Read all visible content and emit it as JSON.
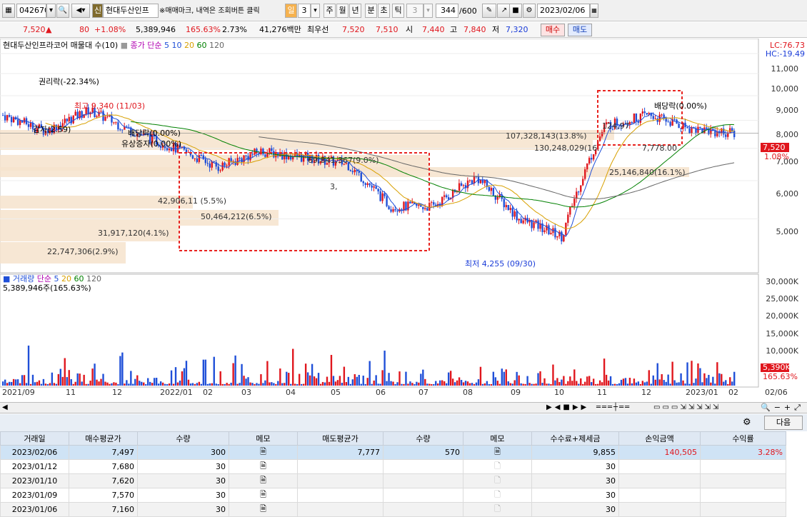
{
  "toolbar": {
    "code": "042670",
    "stock_badge": "신",
    "stock_name": "현대두산인프",
    "hint": "※매매마크, 내역은 조회버튼 클릭",
    "periods": [
      "일",
      "3",
      "주",
      "월",
      "년",
      "분",
      "초",
      "틱"
    ],
    "interval": "3",
    "count": "344",
    "count_max": "/600",
    "date": "2023/02/06"
  },
  "quote": {
    "price": "7,520",
    "change": "80",
    "change_pct": "+1.08%",
    "volume": "5,389,946",
    "volume_pct": "165.63%",
    "turnover": "2.73%",
    "amount": "41,276백만",
    "best_label": "최우선",
    "best_ask": "7,520",
    "best_bid": "7,510",
    "open_label": "시",
    "open": "7,440",
    "high_label": "고",
    "high": "7,840",
    "low_label": "저",
    "low": "7,320",
    "buy_label": "매수",
    "sell_label": "매도"
  },
  "chart": {
    "title": "현대두산인프라코어 매물대 수(10)",
    "ma_label": "종가 단순",
    "ma_periods": [
      "5",
      "10",
      "20",
      "60",
      "120"
    ],
    "lc": "LC:76.73",
    "hc": "HC:-19.49",
    "yticks": [
      "11,000",
      "10,000",
      "9,000",
      "8,000",
      "7,000",
      "6,000",
      "5,000"
    ],
    "last_price": "7,520",
    "last_pct": "1.08%",
    "annotations": {
      "rights": "권리락(-22.34%)",
      "high": "최고 9,340 (11/03)",
      "reduce": "감자(2.59)",
      "div1": "배당락(0.00%)",
      "bonus": "유상증자(0.00%)",
      "div2": "배당락(0.00%)",
      "low": "최저 4,255 (09/30)"
    },
    "profile": [
      "22,747,306(2.9%)",
      "31,917,120(4.1%)",
      "50,464,212(6.5%)",
      "42,906,11 (5.5%)",
      "69,841,367(9.0%)",
      "3,",
      "107,328,143(13.8%)",
      "130,248,029(16.",
      "124,97",
      "7,778.00",
      "25,146,840(16.1%)"
    ],
    "xticks": [
      "2021/09",
      "11",
      "12",
      "2022/01",
      "02",
      "03",
      "04",
      "05",
      "06",
      "07",
      "08",
      "09",
      "10",
      "11",
      "12",
      "2023/01",
      "02",
      "02/06"
    ],
    "volume_label": "거래량",
    "volume_ma_label": "단순",
    "volume_ma": [
      "5",
      "20",
      "60",
      "120"
    ],
    "volume_text": "5,389,946주(165.63%)",
    "vol_yticks": [
      "30,000K",
      "25,000K",
      "20,000K",
      "15,000K",
      "10,000K"
    ],
    "vol_last": "5,390K",
    "vol_last_pct": "165.63%",
    "colors": {
      "up": "#e0161d",
      "down": "#1f4fd8",
      "box": "#e8231f"
    }
  },
  "grid": {
    "next_label": "다음",
    "columns": [
      "거래일",
      "매수평균가",
      "수량",
      "메모",
      "매도평균가",
      "수량",
      "메모",
      "수수료+제세금",
      "손익금액",
      "수익률"
    ],
    "rows": [
      [
        "2023/02/06",
        "7,497",
        "300",
        "",
        "7,777",
        "570",
        "",
        "9,855",
        "140,505",
        "3.28%"
      ],
      [
        "2023/01/12",
        "7,680",
        "30",
        "",
        "",
        "",
        "",
        "30",
        "",
        ""
      ],
      [
        "2023/01/10",
        "7,620",
        "30",
        "",
        "",
        "",
        "",
        "30",
        "",
        ""
      ],
      [
        "2023/01/09",
        "7,570",
        "30",
        "",
        "",
        "",
        "",
        "30",
        "",
        ""
      ],
      [
        "2023/01/06",
        "7,160",
        "30",
        "",
        "",
        "",
        "",
        "30",
        "",
        ""
      ]
    ]
  },
  "chart_data": {
    "type": "candlestick",
    "x": [
      "2021/09",
      "2021/10",
      "2021/11",
      "2021/12",
      "2022/01",
      "2022/02",
      "2022/03",
      "2022/04",
      "2022/05",
      "2022/06",
      "2022/07",
      "2022/08",
      "2022/09",
      "2022/10",
      "2022/11",
      "2022/12",
      "2023/01",
      "2023/02"
    ],
    "close": [
      8200,
      7600,
      8400,
      7600,
      7000,
      6400,
      6900,
      6700,
      6500,
      5300,
      5300,
      6100,
      5000,
      4600,
      7800,
      8200,
      7700,
      7520
    ],
    "ylim": [
      4000,
      11500
    ]
  }
}
